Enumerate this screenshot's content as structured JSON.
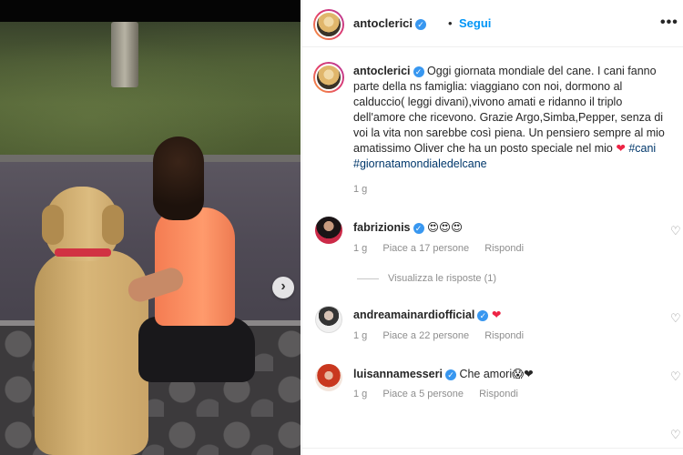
{
  "post": {
    "author": "antoclerici",
    "follow_label": "Segui",
    "separator": "•",
    "more_label": "•••",
    "next_label": "›",
    "verified_mark": "✓"
  },
  "caption": {
    "author": "antoclerici",
    "text": "Oggi giornata mondiale del cane. I cani fanno parte della ns famiglia: viaggiano con noi, dormono al calduccio( leggi divani),vivono amati e ridanno il triplo dell'amore che ricevono. Grazie Argo,Simba,Pepper, senza di voi la vita non sarebbe così piena. Un pensiero sempre al mio amatissimo Oliver che ha un posto speciale nel mio",
    "heart": "❤",
    "tags": [
      "#cani",
      "#giornatamondialedelcane"
    ],
    "time": "1 g"
  },
  "comments": [
    {
      "user": "fabrizionis",
      "text": "😍😍😍",
      "time": "1 g",
      "likes": "Piace a 17 persone",
      "reply": "Rispondi",
      "view_replies": "Visualizza le risposte (1)"
    },
    {
      "user": "andreamainardiofficial",
      "text": "❤",
      "time": "1 g",
      "likes": "Piace a 22 persone",
      "reply": "Rispondi"
    },
    {
      "user": "luisannamesseri",
      "text": "Che amori😱❤",
      "time": "1 g",
      "likes": "Piace a 5 persone",
      "reply": "Rispondi"
    }
  ],
  "icons": {
    "like": "heart-outline-icon",
    "like_glyph": "♡"
  },
  "colors": {
    "follow": "#0095f6",
    "verified": "#3897f0",
    "hashtag": "#00376b",
    "heart": "#ed2445",
    "muted": "#8e8e8e"
  }
}
